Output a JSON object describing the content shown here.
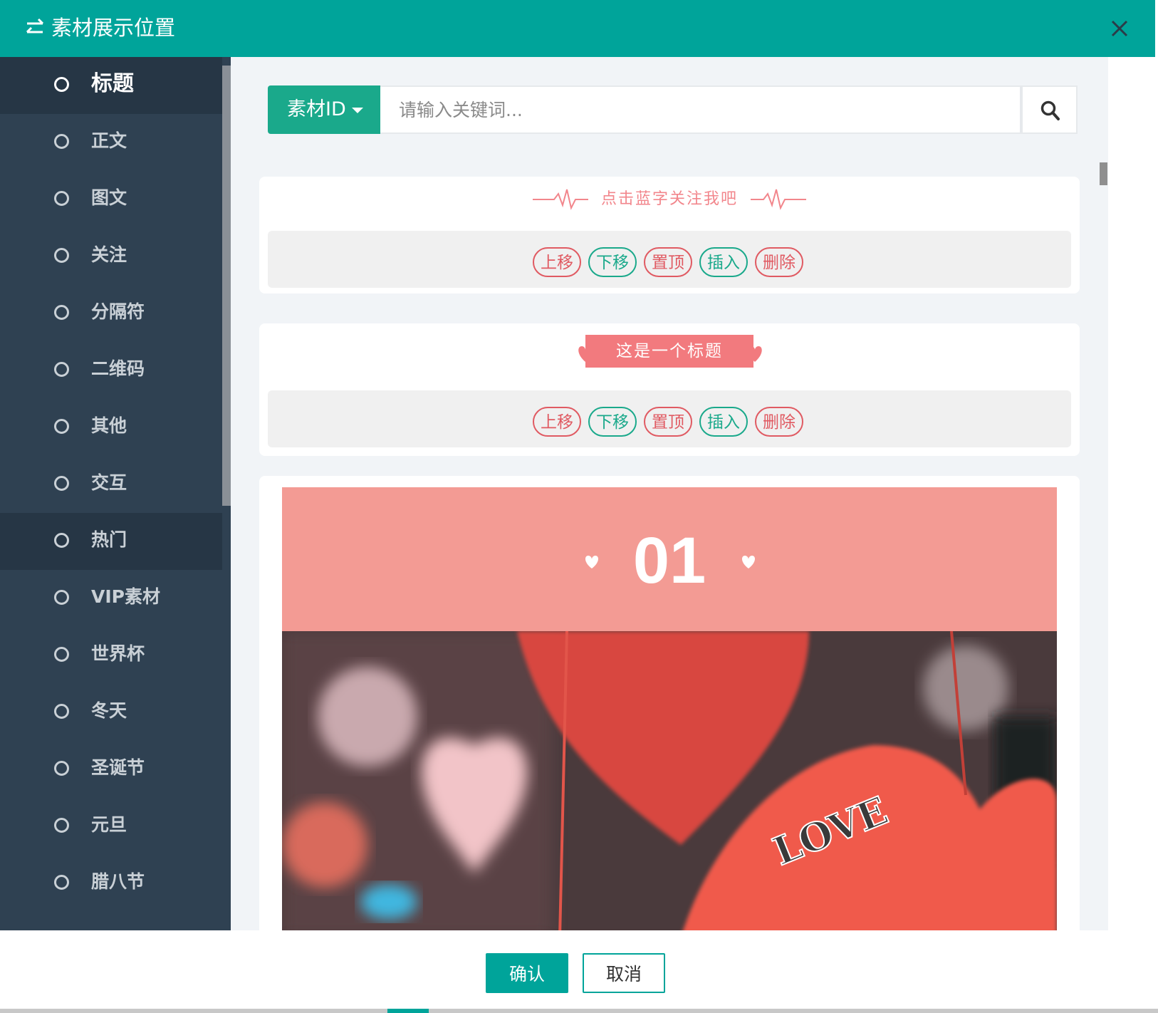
{
  "dialog": {
    "title": "素材展示位置",
    "swap_icon": "swap-arrows-icon",
    "close_icon": "close-icon"
  },
  "sidebar": {
    "items": [
      {
        "label": "标题",
        "active": true
      },
      {
        "label": "正文"
      },
      {
        "label": "图文"
      },
      {
        "label": "关注"
      },
      {
        "label": "分隔符"
      },
      {
        "label": "二维码"
      },
      {
        "label": "其他"
      },
      {
        "label": "交互"
      },
      {
        "label": "热门",
        "highlighted": true
      },
      {
        "label": "VIP素材"
      },
      {
        "label": "世界杯"
      },
      {
        "label": "冬天"
      },
      {
        "label": "圣诞节"
      },
      {
        "label": "元旦"
      },
      {
        "label": "腊八节"
      }
    ]
  },
  "search": {
    "dropdown_label": "素材ID",
    "placeholder": "请输入关键词...",
    "button_icon": "search-icon"
  },
  "cards": [
    {
      "preview_text": "点击蓝字关注我吧",
      "actions": [
        "上移",
        "下移",
        "置顶",
        "插入",
        "删除"
      ]
    },
    {
      "preview_text": "这是一个标题",
      "actions": [
        "上移",
        "下移",
        "置顶",
        "插入",
        "删除"
      ]
    },
    {
      "banner_number": "01"
    }
  ],
  "footer": {
    "confirm_label": "确认",
    "cancel_label": "取消"
  },
  "colors": {
    "header": "#00a49a",
    "sidebar": "#2f4152",
    "accent_green": "#1aa98b",
    "accent_red": "#e05a62",
    "banner": "#f39b94"
  }
}
